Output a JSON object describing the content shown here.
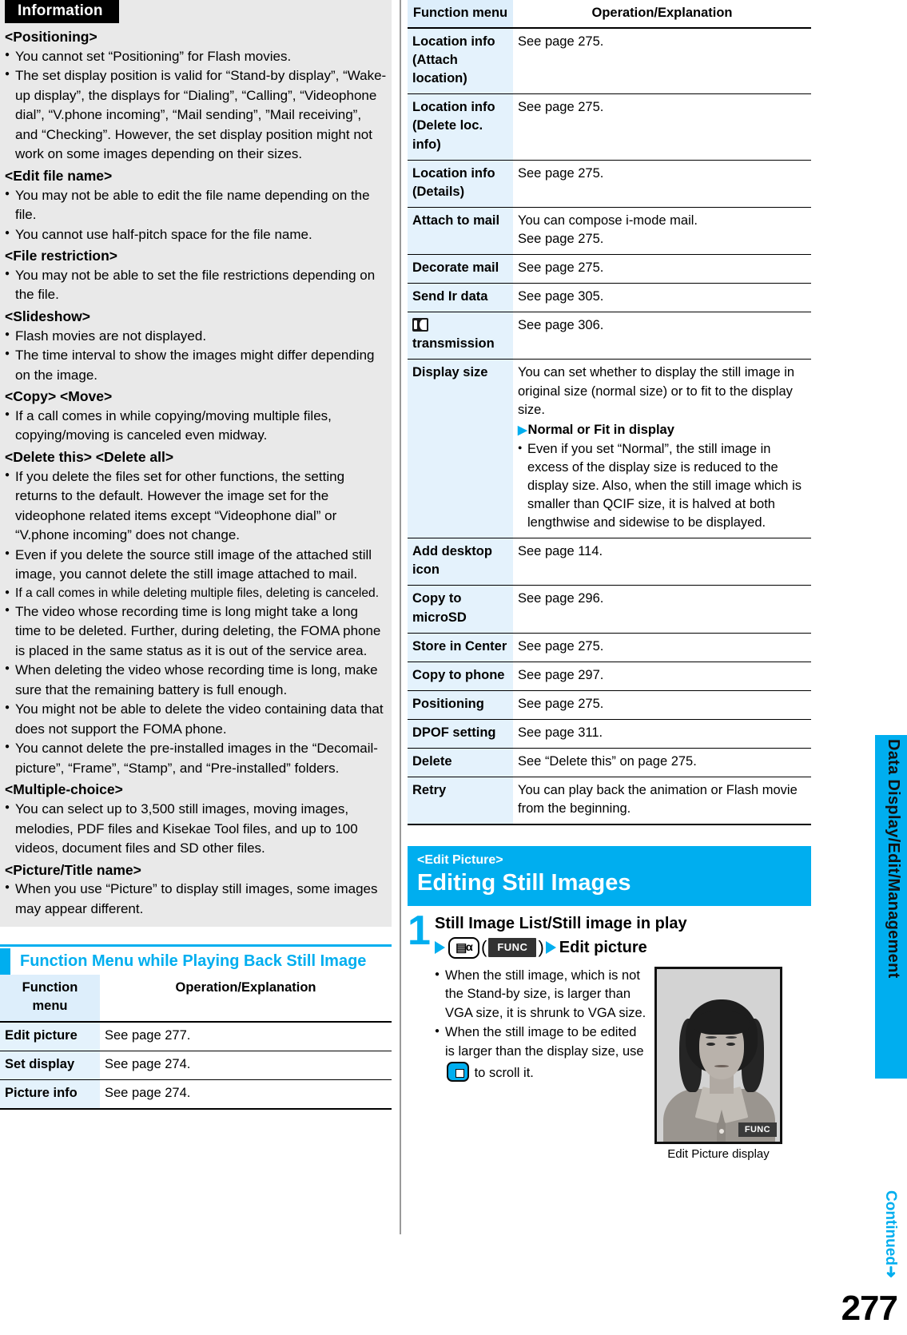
{
  "page": {
    "number": "277",
    "sidebar_label": "Data Display/Edit/Management",
    "continued_label": "Continued",
    "continued_arrow": "➜"
  },
  "information": {
    "tag": "Information",
    "sections": [
      {
        "heading": "<Positioning>",
        "bullets": [
          "You cannot set “Positioning” for Flash movies.",
          "The set display position is valid for “Stand-by display”, “Wake-up display”, the displays for “Dialing”, “Calling”, “Videophone dial”, “V.phone incoming”, “Mail sending”, ”Mail receiving”, and “Checking”. However, the set display position might not work on some images depending on their sizes."
        ]
      },
      {
        "heading": "<Edit file name>",
        "bullets": [
          "You may not be able to edit the file name depending on the file.",
          "You cannot use half-pitch space for the file name."
        ]
      },
      {
        "heading": "<File restriction>",
        "bullets": [
          "You may not be able to set the file restrictions depending on the file."
        ]
      },
      {
        "heading": "<Slideshow>",
        "bullets": [
          "Flash movies are not displayed.",
          "The time interval to show the images might differ depending on the image."
        ]
      },
      {
        "heading": "<Copy> <Move>",
        "bullets": [
          "If a call comes in while copying/moving multiple files, copying/moving is canceled even midway."
        ]
      },
      {
        "heading": "<Delete this> <Delete all>",
        "bullets": [
          "If you delete the files set for other functions, the setting returns to the default. However the image set for the videophone related items except “Videophone dial” or “V.phone incoming” does not change.",
          "Even if you delete the source still image of the attached still image, you cannot delete the still image attached to mail.",
          "If a call comes in while deleting multiple files, deleting is canceled.",
          "The video whose recording time is long might take a long time to be deleted. Further, during deleting, the FOMA phone is placed in the same status as it is out of the service area.",
          "When deleting the video whose recording time is long, make sure that the remaining battery is full enough.",
          "You might not be able to delete the video containing data that does not support the FOMA phone.",
          "You cannot delete the pre-installed images in the “Decomail-picture”, “Frame”, “Stamp”, and “Pre-installed” folders."
        ]
      },
      {
        "heading": "<Multiple-choice>",
        "bullets": [
          "You can select up to 3,500 still images, moving images, melodies, PDF files and Kisekae Tool files, and up to 100 videos, document files and SD other files."
        ]
      },
      {
        "heading": "<Picture/Title name>",
        "bullets": [
          "When you use “Picture” to display still images, some images may appear different."
        ]
      }
    ]
  },
  "left_section": {
    "title": "Function Menu while Playing Back Still Image",
    "table": {
      "headers": [
        "Function menu",
        "Operation/Explanation"
      ],
      "rows": [
        {
          "fn": "Edit picture",
          "op": "See page 277."
        },
        {
          "fn": "Set display",
          "op": "See page 274."
        },
        {
          "fn": "Picture info",
          "op": "See page 274."
        }
      ]
    }
  },
  "right_table": {
    "headers": [
      "Function menu",
      "Operation/Explanation"
    ],
    "rows": [
      {
        "fn": "Location info",
        "fn2": "(Attach location)",
        "op": "See page 275."
      },
      {
        "fn": "Location info",
        "fn2": "(Delete loc. info)",
        "op": "See page 275."
      },
      {
        "fn": "Location info",
        "fn2": "(Details)",
        "op": "See page 275."
      },
      {
        "fn": "Attach to mail",
        "op": "You can compose i-mode mail.",
        "op2": "See page 275."
      },
      {
        "fn": "Decorate mail",
        "op": "See page 275."
      },
      {
        "fn": "Send Ir data",
        "op": "See page 305."
      },
      {
        "fn_icon": "ic-transmission-icon",
        "fn2": "transmission",
        "op": "See page 306."
      },
      {
        "fn": "Display size",
        "op": "You can set whether to display the still image in original size (normal size) or to fit to the display size.",
        "op_sub": "Normal or Fit in display",
        "op_bullet": "Even if you set “Normal”, the still image in excess of the display size is reduced to the display size. Also, when the still image which is smaller than QCIF size, it is halved at both lengthwise and sidewise to be displayed."
      },
      {
        "fn": "Add desktop",
        "fn2": "icon",
        "op": "See page 114."
      },
      {
        "fn": "Copy to",
        "fn2": "microSD",
        "op": "See page 296."
      },
      {
        "fn": "Store in Center",
        "op": "See page 275."
      },
      {
        "fn": "Copy to phone",
        "op": "See page 297."
      },
      {
        "fn": "Positioning",
        "op": "See page 275."
      },
      {
        "fn": "DPOF setting",
        "op": "See page 311."
      },
      {
        "fn": "Delete",
        "op": "See “Delete this” on page 275."
      },
      {
        "fn": "Retry",
        "op": "You can play back the animation or Flash movie from the beginning."
      }
    ]
  },
  "edit_picture": {
    "eyebrow": "<Edit Picture>",
    "title": "Editing Still Images",
    "step_number": "1",
    "step_line1": "Still Image List/Still image in play",
    "func_chip": "FUNC",
    "step_action": "Edit picture",
    "bullets": [
      "When the still image, which is not the Stand-by size, is larger than VGA size, it is shrunk to VGA size.",
      "When the still image to be edited is larger than the display size, use   to scroll it."
    ],
    "bullet2_part1": "When the still image to be edited is larger than the display size, use",
    "bullet2_part2": "to scroll it.",
    "photo_func_label": "FUNC",
    "photo_caption": "Edit Picture display"
  },
  "colors": {
    "accent": "#00AEEF",
    "table_header_bg": "#ddeefb",
    "table_fn_bg": "#e4f2fc",
    "info_bg": "#e9e9e9"
  }
}
